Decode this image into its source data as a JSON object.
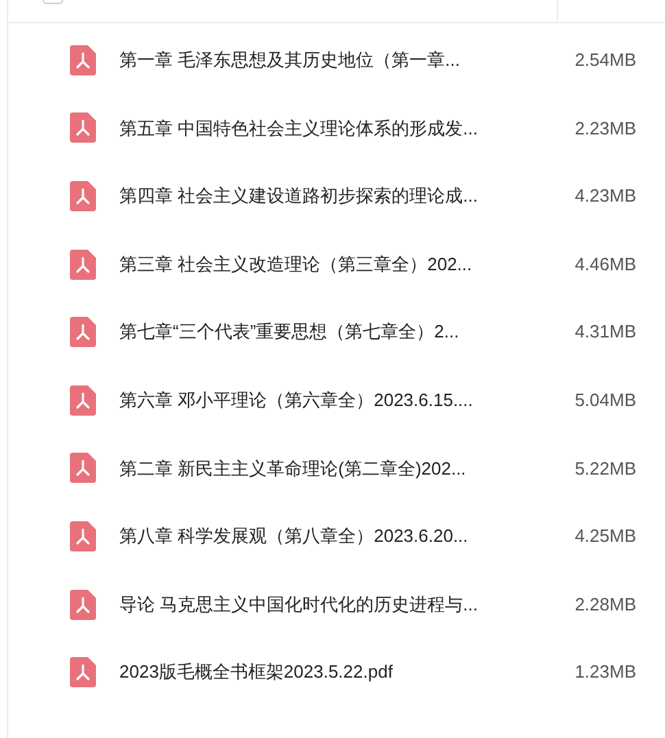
{
  "header": {
    "select_all_checked": false
  },
  "files": [
    {
      "name": "第一章 毛泽东思想及其历史地位（第一章...",
      "size": "2.54MB"
    },
    {
      "name": "第五章 中国特色社会主义理论体系的形成发...",
      "size": "2.23MB"
    },
    {
      "name": "第四章 社会主义建设道路初步探索的理论成...",
      "size": "4.23MB"
    },
    {
      "name": "第三章 社会主义改造理论（第三章全）202...",
      "size": "4.46MB"
    },
    {
      "name": "第七章“三个代表”重要思想（第七章全）2...",
      "size": "4.31MB"
    },
    {
      "name": "第六章 邓小平理论（第六章全）2023.6.15....",
      "size": "5.04MB"
    },
    {
      "name": "第二章 新民主主义革命理论(第二章全)202...",
      "size": "5.22MB"
    },
    {
      "name": "第八章 科学发展观（第八章全）2023.6.20...",
      "size": "4.25MB"
    },
    {
      "name": "导论 马克思主义中国化时代化的历史进程与...",
      "size": "2.28MB"
    },
    {
      "name": "2023版毛概全书框架2023.5.22.pdf",
      "size": "1.23MB"
    }
  ]
}
